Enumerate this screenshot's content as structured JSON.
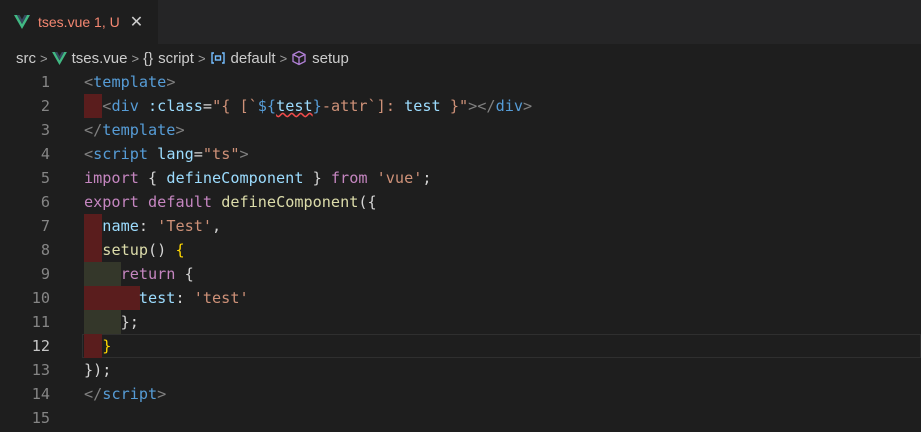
{
  "tab": {
    "label": "tses.vue 1, U",
    "close_glyph": "✕"
  },
  "breadcrumb": {
    "items": [
      {
        "label": "src",
        "icon": null
      },
      {
        "label": "tses.vue",
        "icon": "vue-icon"
      },
      {
        "label": "script",
        "icon": "braces-icon",
        "icon_text": "{}"
      },
      {
        "label": "default",
        "icon": "object-icon"
      },
      {
        "label": "setup",
        "icon": "method-cube-icon"
      }
    ],
    "separator": ">"
  },
  "editor": {
    "active_line": 12,
    "lines": [
      {
        "n": "1",
        "tokens": [
          {
            "t": "<",
            "c": "t-br"
          },
          {
            "t": "template",
            "c": "t-tag"
          },
          {
            "t": ">",
            "c": "t-br"
          }
        ]
      },
      {
        "n": "2",
        "tokens": [
          {
            "t": "  ",
            "c": ""
          },
          {
            "t": "<",
            "c": "t-br"
          },
          {
            "t": "div",
            "c": "t-tag"
          },
          {
            "t": " :class",
            "c": "t-attr"
          },
          {
            "t": "=",
            "c": "t-white"
          },
          {
            "t": "\"{ [`",
            "c": "t-str"
          },
          {
            "t": "${",
            "c": "t-dkw"
          },
          {
            "t": "test",
            "c": "t-var squig"
          },
          {
            "t": "}",
            "c": "t-dkw"
          },
          {
            "t": "-attr`]: ",
            "c": "t-str"
          },
          {
            "t": "test",
            "c": "t-var"
          },
          {
            "t": " }\"",
            "c": "t-str"
          },
          {
            "t": "></",
            "c": "t-br"
          },
          {
            "t": "div",
            "c": "t-tag"
          },
          {
            "t": ">",
            "c": "t-br"
          }
        ]
      },
      {
        "n": "3",
        "tokens": [
          {
            "t": "</",
            "c": "t-br"
          },
          {
            "t": "template",
            "c": "t-tag"
          },
          {
            "t": ">",
            "c": "t-br"
          }
        ]
      },
      {
        "n": "4",
        "tokens": [
          {
            "t": "<",
            "c": "t-br"
          },
          {
            "t": "script",
            "c": "t-tag"
          },
          {
            "t": " lang",
            "c": "t-attr"
          },
          {
            "t": "=",
            "c": "t-white"
          },
          {
            "t": "\"ts\"",
            "c": "t-str"
          },
          {
            "t": ">",
            "c": "t-br"
          }
        ]
      },
      {
        "n": "5",
        "tokens": [
          {
            "t": "import",
            "c": "t-kw"
          },
          {
            "t": " { ",
            "c": "t-white"
          },
          {
            "t": "defineComponent",
            "c": "t-var"
          },
          {
            "t": " } ",
            "c": "t-white"
          },
          {
            "t": "from",
            "c": "t-kw"
          },
          {
            "t": " ",
            "c": ""
          },
          {
            "t": "'vue'",
            "c": "t-str"
          },
          {
            "t": ";",
            "c": "t-white"
          }
        ]
      },
      {
        "n": "6",
        "tokens": [
          {
            "t": "export",
            "c": "t-kw"
          },
          {
            "t": " ",
            "c": ""
          },
          {
            "t": "default",
            "c": "t-kw"
          },
          {
            "t": " ",
            "c": ""
          },
          {
            "t": "defineComponent",
            "c": "t-fn"
          },
          {
            "t": "({",
            "c": "t-white"
          }
        ]
      },
      {
        "n": "7",
        "tokens": [
          {
            "t": "  ",
            "c": ""
          },
          {
            "t": "name",
            "c": "t-var"
          },
          {
            "t": ": ",
            "c": "t-white"
          },
          {
            "t": "'Test'",
            "c": "t-str"
          },
          {
            "t": ",",
            "c": "t-white"
          }
        ]
      },
      {
        "n": "8",
        "tokens": [
          {
            "t": "  ",
            "c": ""
          },
          {
            "t": "setup",
            "c": "t-fn"
          },
          {
            "t": "() ",
            "c": "t-white"
          },
          {
            "t": "{",
            "c": "t-gold"
          }
        ]
      },
      {
        "n": "9",
        "tokens": [
          {
            "t": "    ",
            "c": ""
          },
          {
            "t": "return",
            "c": "t-kw"
          },
          {
            "t": " {",
            "c": "t-white"
          }
        ]
      },
      {
        "n": "10",
        "tokens": [
          {
            "t": "      ",
            "c": ""
          },
          {
            "t": "test",
            "c": "t-var"
          },
          {
            "t": ": ",
            "c": "t-white"
          },
          {
            "t": "'test'",
            "c": "t-str"
          }
        ]
      },
      {
        "n": "11",
        "tokens": [
          {
            "t": "    ",
            "c": ""
          },
          {
            "t": "};",
            "c": "t-white"
          }
        ]
      },
      {
        "n": "12",
        "tokens": [
          {
            "t": "  ",
            "c": ""
          },
          {
            "t": "}",
            "c": "t-gold"
          }
        ]
      },
      {
        "n": "13",
        "tokens": [
          {
            "t": "});",
            "c": "t-white"
          }
        ]
      },
      {
        "n": "14",
        "tokens": [
          {
            "t": "</",
            "c": "t-br"
          },
          {
            "t": "script",
            "c": "t-tag"
          },
          {
            "t": ">",
            "c": "t-br"
          }
        ]
      },
      {
        "n": "15",
        "tokens": []
      }
    ]
  },
  "colors": {
    "background": "#1e1e1e",
    "tab_modified": "#f48771",
    "indent_error": "#5a1d1d",
    "indent_warn": "#34372a",
    "vue_green": "#41b883",
    "vue_dark": "#35495e"
  }
}
